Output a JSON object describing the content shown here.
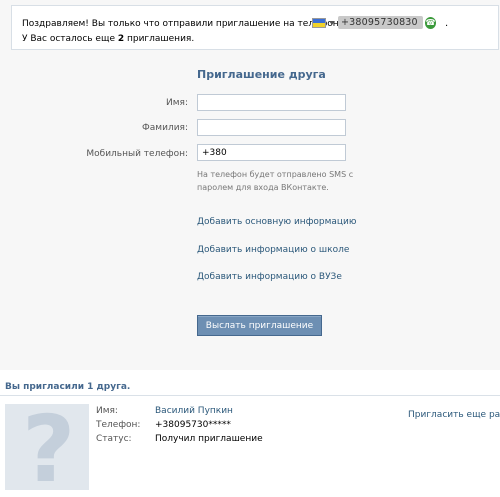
{
  "notice": {
    "line1": "Поздравляем! Вы только что отправили приглашение на телефон",
    "phone_masked": "+38095730830",
    "line2_prefix": "У Вас осталось еще ",
    "line2_count": "2",
    "line2_suffix": " приглашения.",
    "dot": "."
  },
  "form": {
    "title": "Приглашение друга",
    "first_name_label": "Имя:",
    "first_name_value": "",
    "last_name_label": "Фамилия:",
    "last_name_value": "",
    "phone_label": "Мобильный телефон:",
    "phone_value": "+380",
    "hint": "На телефон будет отправлено SMS с паролем для входа ВКонтакте.",
    "link_basic": "Добавить основную информацию",
    "link_school": "Добавить информацию о школе",
    "link_university": "Добавить информацию о ВУЗе",
    "send_button": "Выслать приглашение"
  },
  "invited": {
    "title": "Вы пригласили 1 друга.",
    "name_label": "Имя:",
    "name_value": "Василий Пупкин",
    "phone_label": "Телефон:",
    "phone_value": "+38095730*****",
    "status_label": "Статус:",
    "status_value": "Получил приглашение",
    "reinvite": "Пригласить еще раз",
    "avatar_glyph": "?"
  }
}
